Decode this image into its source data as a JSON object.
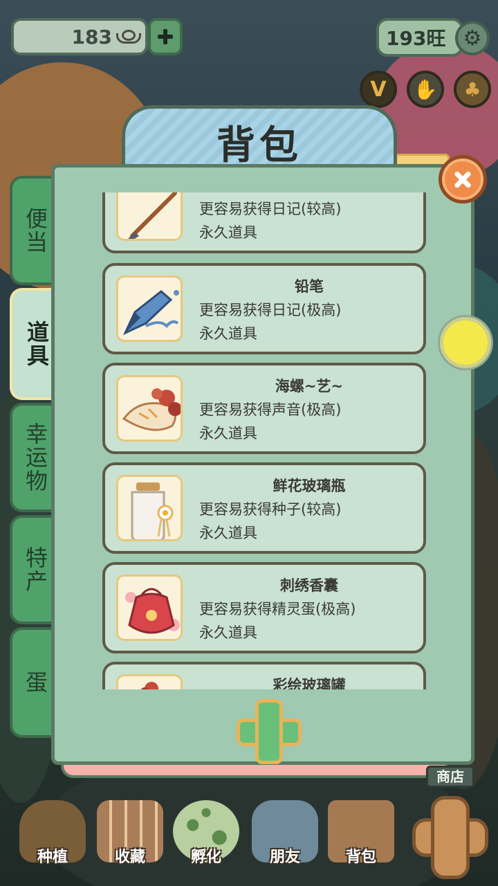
{
  "hud": {
    "coins": "183",
    "wang": "193旺"
  },
  "panel": {
    "title": "背包"
  },
  "tabs": [
    {
      "label": "便当",
      "active": false
    },
    {
      "label": "道具",
      "active": true
    },
    {
      "label": "幸运物",
      "active": false
    },
    {
      "label": "特产",
      "active": false
    },
    {
      "label": "蛋",
      "active": false
    }
  ],
  "items": [
    {
      "name": "",
      "desc": "更容易获得日记(较高)",
      "perm": "永久道具",
      "icon": "brush-icon"
    },
    {
      "name": "铅笔",
      "desc": "更容易获得日记(极高)",
      "perm": "永久道具",
      "icon": "pencil-icon"
    },
    {
      "name": "海螺~艺~",
      "desc": "更容易获得声音(极高)",
      "perm": "永久道具",
      "icon": "conch-icon"
    },
    {
      "name": "鲜花玻璃瓶",
      "desc": "更容易获得种子(较高)",
      "perm": "永久道具",
      "icon": "flower-bottle-icon"
    },
    {
      "name": "刺绣香囊",
      "desc": "更容易获得精灵蛋(极高)",
      "perm": "永久道具",
      "icon": "sachet-icon"
    },
    {
      "name": "彩绘玻璃罐",
      "desc": "",
      "perm": "",
      "icon": "glass-jar-icon"
    }
  ],
  "shop": {
    "label": "商店"
  },
  "nav": [
    {
      "label": "种植",
      "icon": "plant-icon"
    },
    {
      "label": "收藏",
      "icon": "collection-icon"
    },
    {
      "label": "孵化",
      "icon": "egg-icon"
    },
    {
      "label": "朋友",
      "icon": "cat-icon"
    },
    {
      "label": "背包",
      "icon": "backpack-icon"
    }
  ]
}
